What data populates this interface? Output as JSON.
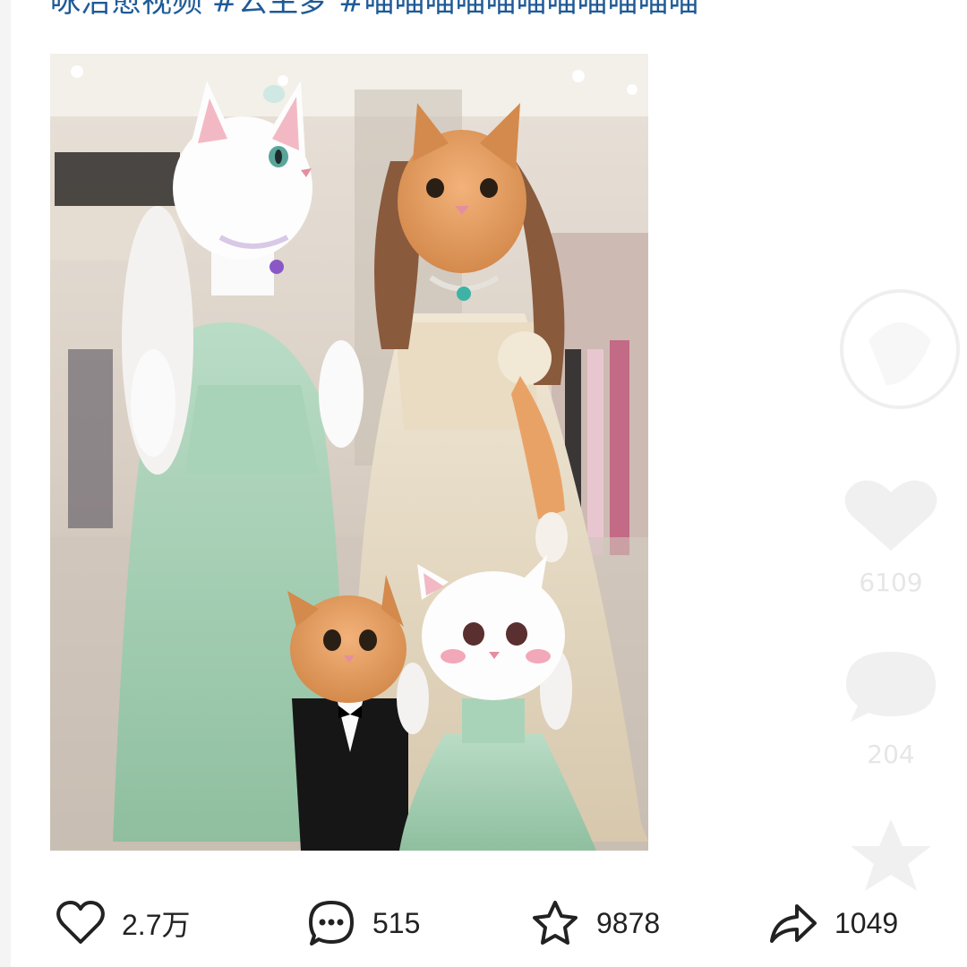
{
  "post": {
    "caption": "咏治愈视频 #公主梦 #喵喵喵喵喵喵喵喵喵喵喵",
    "image_alt": "Four cats in gowns and a tuxedo standing in a shopping mall"
  },
  "video_rail": {
    "like_count": "6109",
    "comment_count": "204"
  },
  "actions": {
    "like": {
      "icon": "heart-outline-icon",
      "count": "2.7万"
    },
    "comment": {
      "icon": "speech-bubble-icon",
      "count": "515"
    },
    "favorite": {
      "icon": "star-outline-icon",
      "count": "9878"
    },
    "share": {
      "icon": "share-arrow-icon",
      "count": "1049"
    }
  },
  "colors": {
    "caption_link": "#1f5a96",
    "icon": "#222222"
  }
}
